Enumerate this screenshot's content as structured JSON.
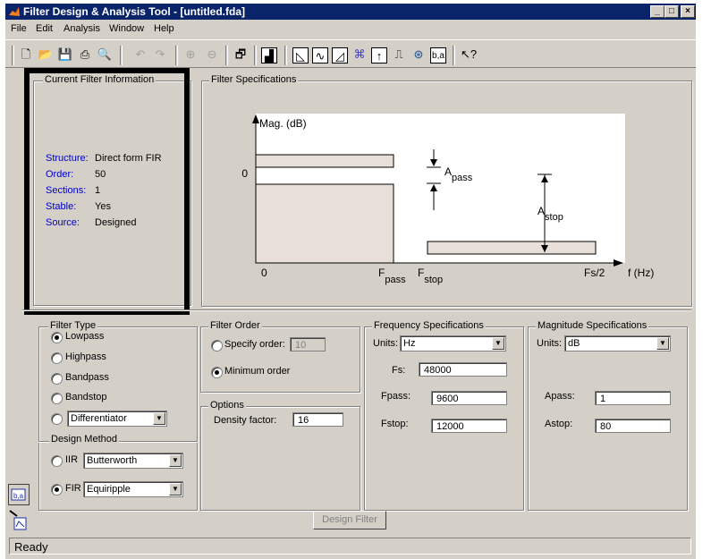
{
  "window": {
    "title": "Filter Design & Analysis Tool - [untitled.fda]"
  },
  "window_buttons": [
    "_",
    "□",
    "×"
  ],
  "menu": [
    "File",
    "Edit",
    "Analysis",
    "Window",
    "Help"
  ],
  "current_filter": {
    "legend": "Current Filter Information",
    "rows": [
      {
        "key": "Structure:",
        "value": "Direct form FIR"
      },
      {
        "key": "Order:",
        "value": "50"
      },
      {
        "key": "Sections:",
        "value": "1"
      },
      {
        "key": "Stable:",
        "value": "Yes"
      },
      {
        "key": "Source:",
        "value": "Designed"
      }
    ]
  },
  "filter_specs": {
    "legend": "Filter Specifications",
    "ylabel": "Mag. (dB)",
    "zero_y": "0",
    "zero_x": "0",
    "apass_main": "A",
    "apass_sub": "pass",
    "astop_main": "A",
    "astop_sub": "stop",
    "fpass_main": "F",
    "fpass_sub": "pass",
    "fstop_main": "F",
    "fstop_sub": "stop",
    "fs2": "Fs/2",
    "xlabel": "f (Hz)"
  },
  "filter_type": {
    "legend": "Filter Type",
    "options": [
      "Lowpass",
      "Highpass",
      "Bandpass",
      "Bandstop"
    ],
    "selected": "Lowpass",
    "other_select": "Differentiator"
  },
  "design_method": {
    "legend": "Design Method",
    "iir_label": "IIR",
    "iir_select": "Butterworth",
    "fir_label": "FIR",
    "fir_select": "Equiripple",
    "selected": "FIR"
  },
  "filter_order": {
    "legend": "Filter Order",
    "specify_label": "Specify order:",
    "specify_value": "10",
    "minimum_label": "Minimum order",
    "selected": "Minimum order"
  },
  "options": {
    "legend": "Options",
    "density_label": "Density factor:",
    "density_value": "16"
  },
  "freq_specs": {
    "legend": "Frequency Specifications",
    "units_label": "Units:",
    "units_value": "Hz",
    "fs_label": "Fs:",
    "fs_value": "48000",
    "fpass_label": "Fpass:",
    "fpass_value": "9600",
    "fstop_label": "Fstop:",
    "fstop_value": "12000"
  },
  "mag_specs": {
    "legend": "Magnitude Specifications",
    "units_label": "Units:",
    "units_value": "dB",
    "apass_label": "Apass:",
    "apass_value": "1",
    "astop_label": "Astop:",
    "astop_value": "80"
  },
  "design_button": "Design Filter",
  "status": "Ready",
  "colors": {
    "title_bar": "#0a246a",
    "face": "#d4d0c8",
    "band_fill": "#e8e0d8",
    "label_blue": "#0000c0"
  }
}
